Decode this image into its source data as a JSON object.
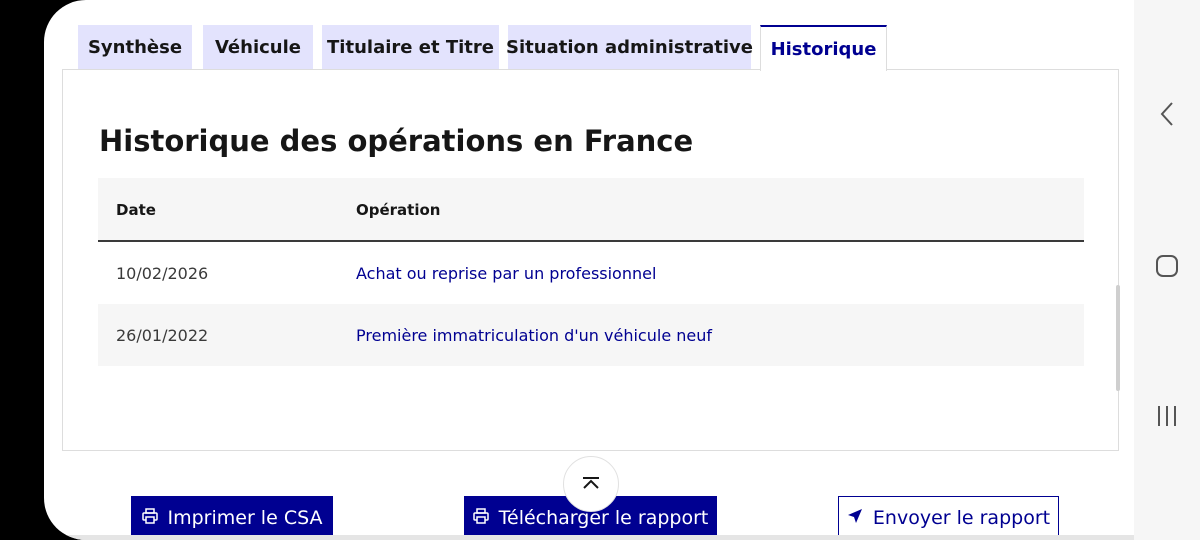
{
  "tabs": [
    {
      "label": "Synthèse"
    },
    {
      "label": "Véhicule"
    },
    {
      "label": "Titulaire et Titre"
    },
    {
      "label": "Situation administrative"
    },
    {
      "label": "Historique",
      "active": true
    }
  ],
  "panel": {
    "title": "Historique des opérations en France",
    "table": {
      "headers": {
        "date": "Date",
        "operation": "Opération"
      },
      "rows": [
        {
          "date": "10/02/2026",
          "operation": "Achat ou reprise par un professionnel"
        },
        {
          "date": "26/01/2022",
          "operation": "Première immatriculation d'un véhicule neuf"
        }
      ]
    }
  },
  "actions": {
    "print": "Imprimer le CSA",
    "download": "Télécharger le rapport",
    "send": "Envoyer le rapport"
  },
  "icons": {
    "scroll_top": "chevron-up-icon",
    "print": "printer-icon",
    "send": "send-icon",
    "nav_back": "chevron-left-icon",
    "nav_home": "home-square-icon",
    "nav_recents": "recents-icon"
  },
  "colors": {
    "accent": "#000091",
    "tab_inactive_bg": "#e3e3fd",
    "row_alt_bg": "#f6f6f6"
  }
}
